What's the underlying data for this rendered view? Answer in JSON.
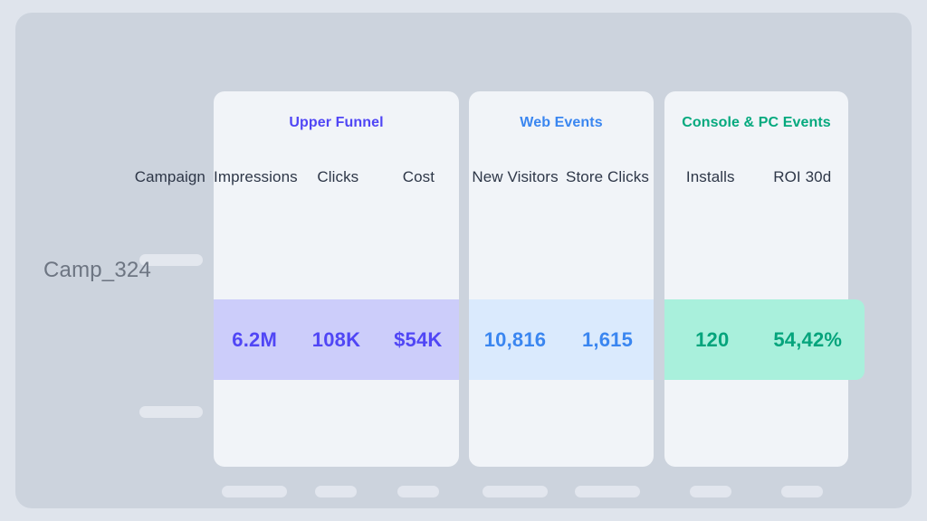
{
  "colors": {
    "page_background": "#dfe4ec",
    "panel_background": "#ccd3dd",
    "card_background": "#f1f4f8",
    "skeleton": "#e2e6ee",
    "upper_funnel_accent": "#5046f5",
    "web_events_accent": "#3a86f0",
    "console_pc_accent": "#05a97e",
    "upper_funnel_row": "#cccdfa",
    "web_events_row": "#daeafd",
    "console_pc_row": "#a9f0dc",
    "header_text": "#2e3748",
    "row_label_text": "#6d7582"
  },
  "row_label_column": {
    "header": "Campaign",
    "active_row_label": "Camp_324"
  },
  "groups": [
    {
      "id": "upper-funnel",
      "title": "Upper Funnel",
      "columns": [
        "Impressions",
        "Clicks",
        "Cost"
      ],
      "active_values": [
        "6.2M",
        "108K",
        "$54K"
      ]
    },
    {
      "id": "web-events",
      "title": "Web Events",
      "columns": [
        "New Visitors",
        "Store Clicks"
      ],
      "active_values": [
        "10,816",
        "1,615"
      ]
    },
    {
      "id": "console-pc-events",
      "title": "Console & PC Events",
      "columns": [
        "Installs",
        "ROI 30d"
      ],
      "active_values": [
        "120",
        "54,42%"
      ]
    }
  ]
}
